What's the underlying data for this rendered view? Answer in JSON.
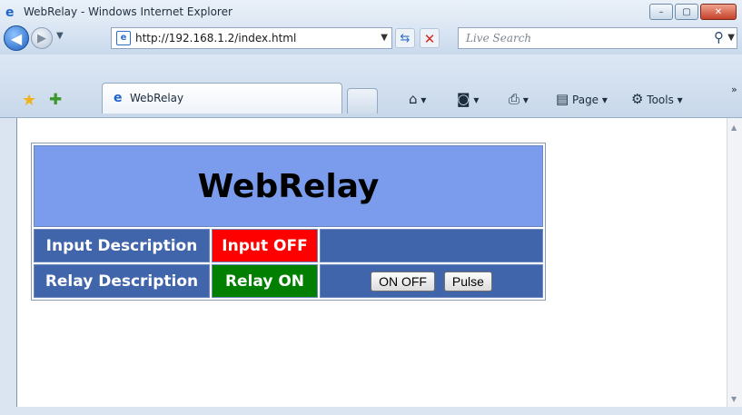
{
  "window": {
    "title": "WebRelay - Windows Internet Explorer",
    "controls": {
      "minimize": "–",
      "maximize": "▢",
      "close": "✕"
    }
  },
  "toolbar": {
    "back_icon": "back-arrow-icon",
    "forward_icon": "forward-arrow-icon",
    "address": "http://192.168.1.2/index.html",
    "search_placeholder": "Live Search"
  },
  "tabs": [
    {
      "label": "WebRelay"
    }
  ],
  "commands": {
    "page": "Page",
    "tools": "Tools"
  },
  "page": {
    "heading": "WebRelay",
    "rows": [
      {
        "label": "Input Description",
        "status": "Input OFF",
        "status_color": "#ff0000"
      },
      {
        "label": "Relay Description",
        "status": "Relay ON",
        "status_color": "#007f00",
        "buttons": [
          "ON OFF",
          "Pulse"
        ]
      }
    ]
  },
  "colors": {
    "header_bg": "#7b9cec",
    "row_bg": "#4065ab"
  }
}
